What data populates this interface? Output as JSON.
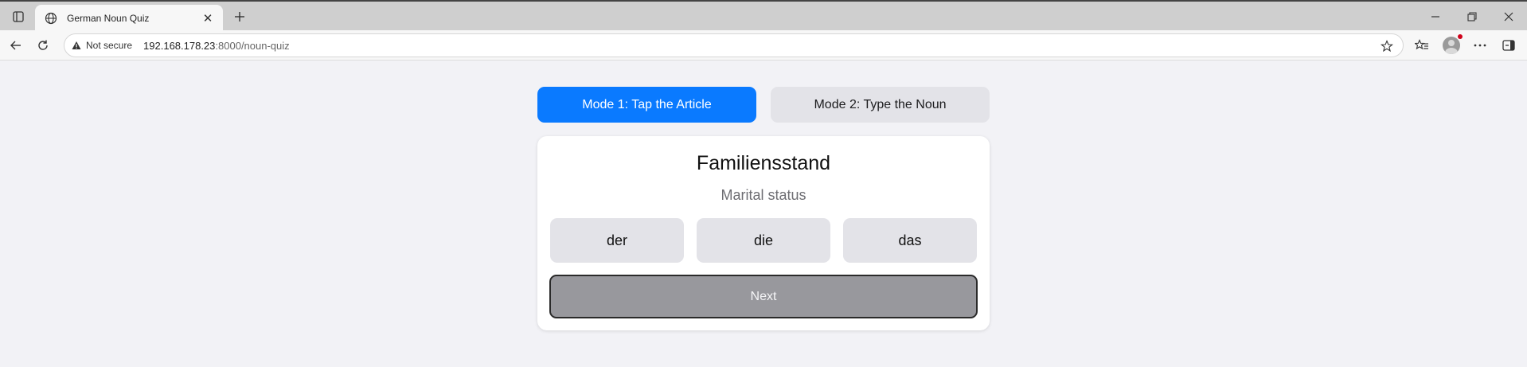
{
  "browser": {
    "tab_title": "German Noun Quiz",
    "security_label": "Not secure",
    "url_host": "192.168.178.23",
    "url_rest": ":8000/noun-quiz"
  },
  "quiz": {
    "modes": [
      {
        "label": "Mode 1: Tap the Article",
        "active": true
      },
      {
        "label": "Mode 2: Type the Noun",
        "active": false
      }
    ],
    "noun": "Familiensstand",
    "translation": "Marital status",
    "articles": [
      "der",
      "die",
      "das"
    ],
    "next_label": "Next"
  },
  "colors": {
    "accent": "#0a7aff",
    "button_bg": "#e3e3e8",
    "next_disabled": "#98989d",
    "page_bg": "#f2f2f6"
  }
}
